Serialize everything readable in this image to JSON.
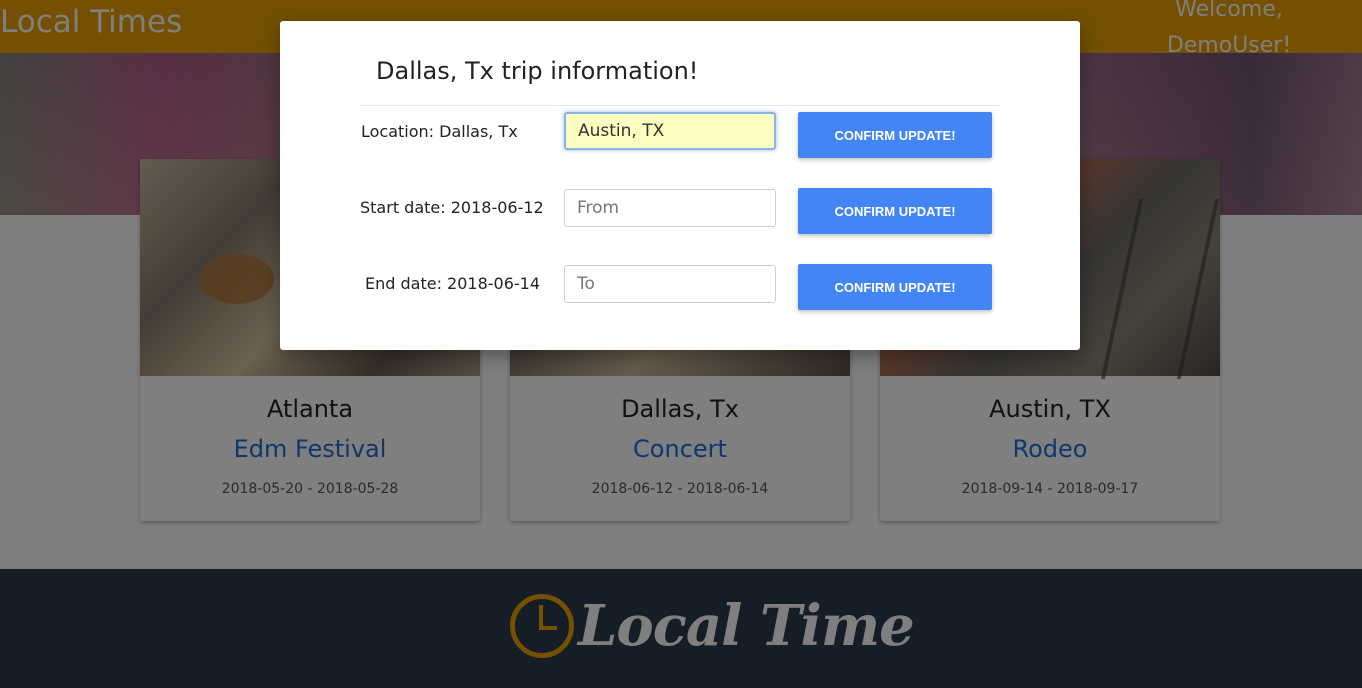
{
  "navbar": {
    "brand": "Local Times",
    "welcome": "Welcome, DemoUser!"
  },
  "cards": [
    {
      "city": "Atlanta",
      "event": "Edm Festival",
      "dates": "2018-05-20 - 2018-05-28"
    },
    {
      "city": "Dallas, Tx",
      "event": "Concert",
      "dates": "2018-06-12 - 2018-06-14"
    },
    {
      "city": "Austin, TX",
      "event": "Rodeo",
      "dates": "2018-09-14 - 2018-09-17"
    }
  ],
  "footer": {
    "logo_text": "Local Time"
  },
  "modal": {
    "title": "Dallas, Tx trip information!",
    "rows": [
      {
        "label": "Location: Dallas, Tx",
        "value": "Austin, TX",
        "placeholder": "",
        "button": "CONFIRM UPDATE!"
      },
      {
        "label": "Start date: 2018-06-12",
        "value": "",
        "placeholder": "From",
        "button": "CONFIRM UPDATE!"
      },
      {
        "label": "End date: 2018-06-14",
        "value": "",
        "placeholder": "To",
        "button": "CONFIRM UPDATE!"
      }
    ]
  },
  "colors": {
    "brand": "#e8a100",
    "button": "#4285f4",
    "link": "#1d6fd6",
    "footer": "#2a3a4d"
  }
}
